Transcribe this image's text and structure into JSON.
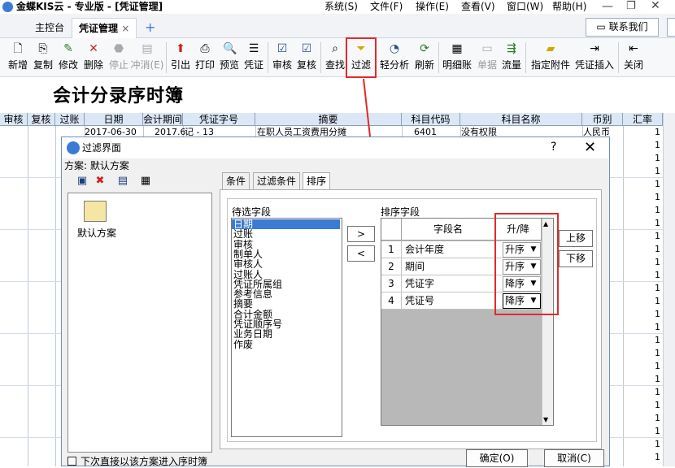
{
  "app": {
    "title": "金蝶KIS云 - 专业版 - [凭证管理]"
  },
  "menu": [
    "系统(S)",
    "文件(F)",
    "操作(E)",
    "查看(V)",
    "窗口(W)",
    "帮助(H)"
  ],
  "tabs": {
    "home": "主控台",
    "voucher": "凭证管理",
    "close": "×",
    "add": "+"
  },
  "contact": "联系我们",
  "toolbar": [
    {
      "label": "新增",
      "icon": "new-doc-icon"
    },
    {
      "label": "复制",
      "icon": "copy-icon"
    },
    {
      "label": "修改",
      "icon": "edit-icon"
    },
    {
      "label": "删除",
      "icon": "delete-x-icon"
    },
    {
      "label": "停止",
      "icon": "stop-icon"
    },
    {
      "label": "冲消(E)",
      "icon": "reverse-icon"
    },
    {
      "label": "引出",
      "icon": "export-icon"
    },
    {
      "label": "打印",
      "icon": "print-icon"
    },
    {
      "label": "预览",
      "icon": "preview-icon"
    },
    {
      "label": "凭证",
      "icon": "voucher-icon"
    },
    {
      "label": "审核",
      "icon": "audit-icon"
    },
    {
      "label": "复核",
      "icon": "review-icon"
    },
    {
      "label": "查找",
      "icon": "find-icon"
    },
    {
      "label": "过滤",
      "icon": "filter-icon"
    },
    {
      "label": "轻分析",
      "icon": "analysis-icon"
    },
    {
      "label": "刷新",
      "icon": "refresh-icon"
    },
    {
      "label": "明细账",
      "icon": "ledger-icon"
    },
    {
      "label": "单据",
      "icon": "document-icon"
    },
    {
      "label": "流量",
      "icon": "flow-icon"
    },
    {
      "label": "指定附件",
      "icon": "folder-icon"
    },
    {
      "label": "凭证插入",
      "icon": "insert-icon"
    },
    {
      "label": "关闭",
      "icon": "close-door-icon"
    }
  ],
  "journal": {
    "title": "会计分录序时簿",
    "columns": [
      "审核",
      "复核",
      "过账",
      "日期",
      "会计期间",
      "凭证字号",
      "摘要",
      "科目代码",
      "科目名称",
      "币别",
      "汇率"
    ],
    "row": {
      "date": "2017-06-30",
      "period": "2017.6",
      "voucher": "记 - 13",
      "summary": "在职人员工资费用分摊",
      "code": "6401",
      "name": "没有权限",
      "currency": "人民币",
      "rate": "1"
    },
    "rates": [
      "1",
      "1",
      "1",
      "1",
      "1",
      "1",
      "1",
      "1",
      "1",
      "1",
      "1",
      "1",
      "1",
      "1",
      "1",
      "1",
      "1",
      "1",
      "1",
      "1",
      "1",
      "1",
      "1",
      "1",
      "1",
      "1",
      "1",
      "1",
      "1"
    ]
  },
  "dialog": {
    "title": "过滤界面",
    "help": "?",
    "close": "✕",
    "scheme_label": "方案: 默认方案",
    "scheme_name": "默认方案",
    "tabs": [
      "条件",
      "过滤条件",
      "排序"
    ],
    "available_label": "待选字段",
    "available_fields": [
      "日期",
      "过账",
      "审核",
      "制单人",
      "审核人",
      "过账人",
      "凭证所属组",
      "参考信息",
      "摘要",
      "合计金额",
      "凭证顺序号",
      "业务日期",
      "作废"
    ],
    "sort_label": "排序字段",
    "sort_headers": [
      "字段名",
      "升/降"
    ],
    "sort_rows": [
      {
        "no": "1",
        "field": "会计年度",
        "order": "升序"
      },
      {
        "no": "2",
        "field": "期间",
        "order": "升序"
      },
      {
        "no": "3",
        "field": "凭证字",
        "order": "降序"
      },
      {
        "no": "4",
        "field": "凭证号",
        "order": "降序"
      }
    ],
    "btn_add": ">",
    "btn_remove": "<",
    "btn_up": "上移",
    "btn_down": "下移",
    "checkbox_label": "下次直接以该方案进入序时簿",
    "btn_ok": "确定(O)",
    "btn_cancel": "取消(C)"
  },
  "colors": {
    "highlight": "#e02a2a",
    "selection": "#3a7bd5"
  }
}
